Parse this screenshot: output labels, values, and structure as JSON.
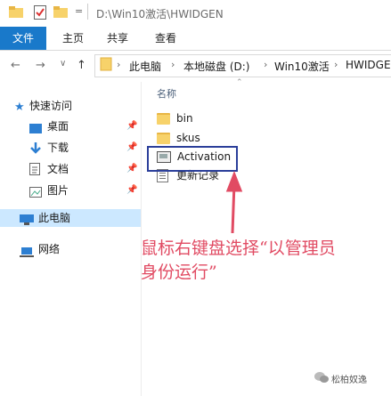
{
  "window": {
    "title_path": "D:\\Win10激活\\HWIDGEN",
    "qa_dropdown": "="
  },
  "ribbon": {
    "tabs": [
      "文件",
      "主页",
      "共享",
      "查看"
    ]
  },
  "address": {
    "back": "←",
    "forward": "→",
    "recent": "∨",
    "up": "↑",
    "crumbs": [
      "此电脑",
      "本地磁盘 (D:)",
      "Win10激活",
      "HWIDGE"
    ],
    "separator": "›"
  },
  "nav": {
    "quick_access": "快速访问",
    "items": [
      {
        "label": "桌面",
        "icon": "desktop-icon"
      },
      {
        "label": "下载",
        "icon": "download-icon"
      },
      {
        "label": "文档",
        "icon": "documents-icon"
      },
      {
        "label": "图片",
        "icon": "pictures-icon"
      }
    ],
    "this_pc": "此电脑",
    "network": "网络"
  },
  "content": {
    "column_name": "名称",
    "files": [
      {
        "name": "bin",
        "type": "folder"
      },
      {
        "name": "skus",
        "type": "folder"
      },
      {
        "name": "Activation",
        "type": "batch"
      },
      {
        "name": "更新记录",
        "type": "text"
      }
    ]
  },
  "annotation": {
    "line1": "鼠标右键盘选择“以管理员",
    "line2": "身份运行”",
    "color": "#e14b63"
  },
  "watermark": "松柏奴逸"
}
